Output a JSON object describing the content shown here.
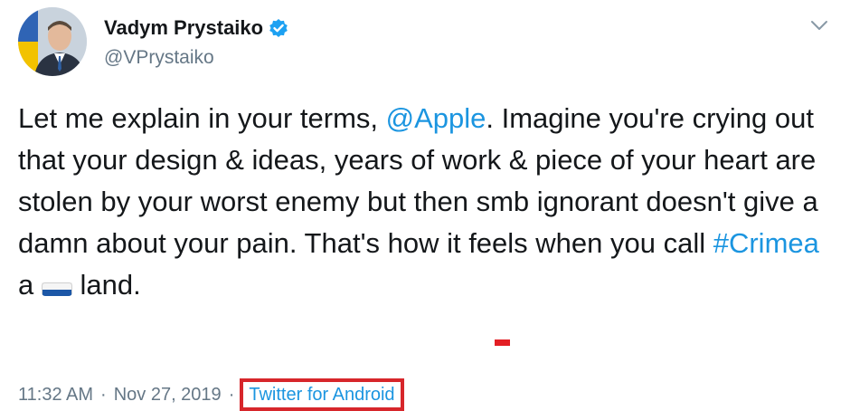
{
  "author": {
    "display_name": "Vadym Prystaiko",
    "handle": "@VPrystaiko",
    "avatar_icon": "person-avatar",
    "verified_icon": "verified-badge-icon"
  },
  "tweet": {
    "text_1": "Let me explain in your terms, ",
    "mention": "@Apple",
    "text_2": ". Imagine you're crying out that your design & ideas, years of work & piece of your heart are stolen by your worst enemy but then smb ignorant doesn't give a damn about your pain. That's how it feels when you call ",
    "hashtag": "#Crimea",
    "text_3": " a ",
    "flag_icon": "russia-flag-icon",
    "text_4": " land."
  },
  "meta": {
    "time": "11:32 AM",
    "separator": "·",
    "date": "Nov 27, 2019",
    "separator2": "·",
    "source": "Twitter for Android"
  },
  "colors": {
    "link": "#1b95e0",
    "text": "#14171a",
    "muted": "#657786",
    "highlight_box": "#d7262b"
  }
}
